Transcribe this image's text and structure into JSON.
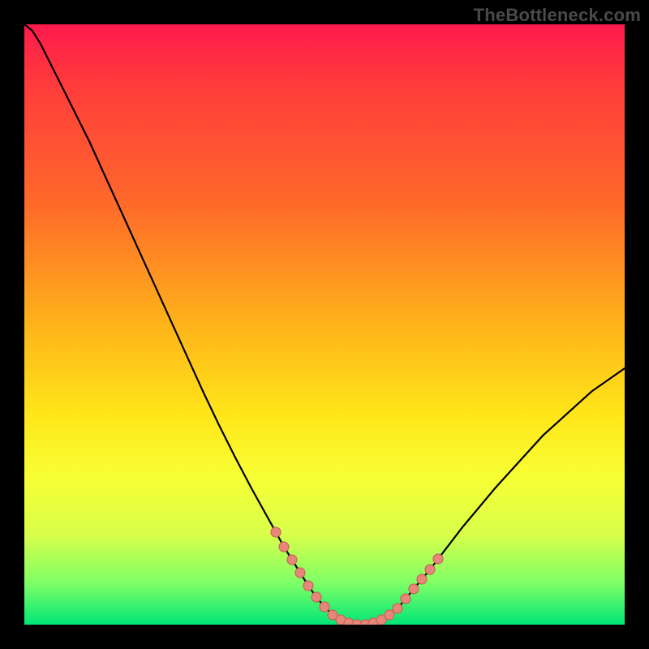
{
  "watermark": "TheBottleneck.com",
  "colors": {
    "frame": "#000000",
    "gradient_top": "#ff1a4d",
    "gradient_bottom": "#00e676",
    "curve": "#000000",
    "marker_fill": "#e9867a",
    "marker_stroke": "#c76659"
  },
  "chart_data": {
    "type": "line",
    "title": "",
    "xlabel": "",
    "ylabel": "",
    "xlim": [
      0,
      100
    ],
    "ylim": [
      0,
      100
    ],
    "grid": false,
    "legend": false,
    "annotations": [],
    "series": [
      {
        "name": "bottleneck-curve",
        "x": [
          0,
          1.35,
          2.7,
          4.05,
          5.41,
          8.11,
          10.81,
          13.51,
          16.22,
          18.92,
          21.62,
          24.32,
          27.03,
          29.73,
          32.43,
          35.14,
          37.84,
          40.54,
          41.89,
          43.24,
          44.59,
          45.95,
          47.3,
          48.65,
          50.0,
          51.35,
          52.7,
          54.05,
          55.41,
          56.76,
          58.11,
          59.46,
          60.81,
          62.16,
          63.51,
          64.86,
          67.57,
          70.27,
          72.97,
          75.68,
          78.38,
          81.08,
          83.78,
          86.49,
          89.19,
          91.89,
          94.59,
          97.3,
          100.0
        ],
        "y": [
          100.0,
          98.92,
          96.76,
          94.05,
          91.35,
          85.95,
          80.54,
          74.59,
          68.65,
          62.7,
          56.76,
          50.81,
          44.86,
          38.92,
          33.24,
          27.84,
          22.7,
          17.84,
          15.41,
          12.97,
          10.81,
          8.65,
          6.49,
          4.59,
          2.97,
          1.62,
          0.81,
          0.27,
          0.0,
          0.0,
          0.27,
          0.81,
          1.62,
          2.7,
          4.32,
          5.95,
          9.19,
          12.7,
          16.22,
          19.46,
          22.7,
          25.68,
          28.65,
          31.62,
          34.05,
          36.49,
          38.92,
          40.81,
          42.7
        ]
      }
    ],
    "markers": {
      "name": "highlighted-points",
      "x": [
        41.89,
        43.24,
        44.59,
        45.95,
        47.3,
        48.65,
        50.0,
        51.35,
        52.7,
        54.05,
        55.41,
        56.76,
        58.11,
        59.46,
        60.81,
        62.16,
        63.51,
        64.86,
        66.22,
        67.57,
        68.92
      ],
      "y": [
        15.41,
        12.97,
        10.81,
        8.65,
        6.49,
        4.59,
        2.97,
        1.62,
        0.81,
        0.27,
        0.0,
        0.0,
        0.27,
        0.81,
        1.62,
        2.7,
        4.32,
        5.95,
        7.57,
        9.19,
        10.95
      ]
    }
  }
}
